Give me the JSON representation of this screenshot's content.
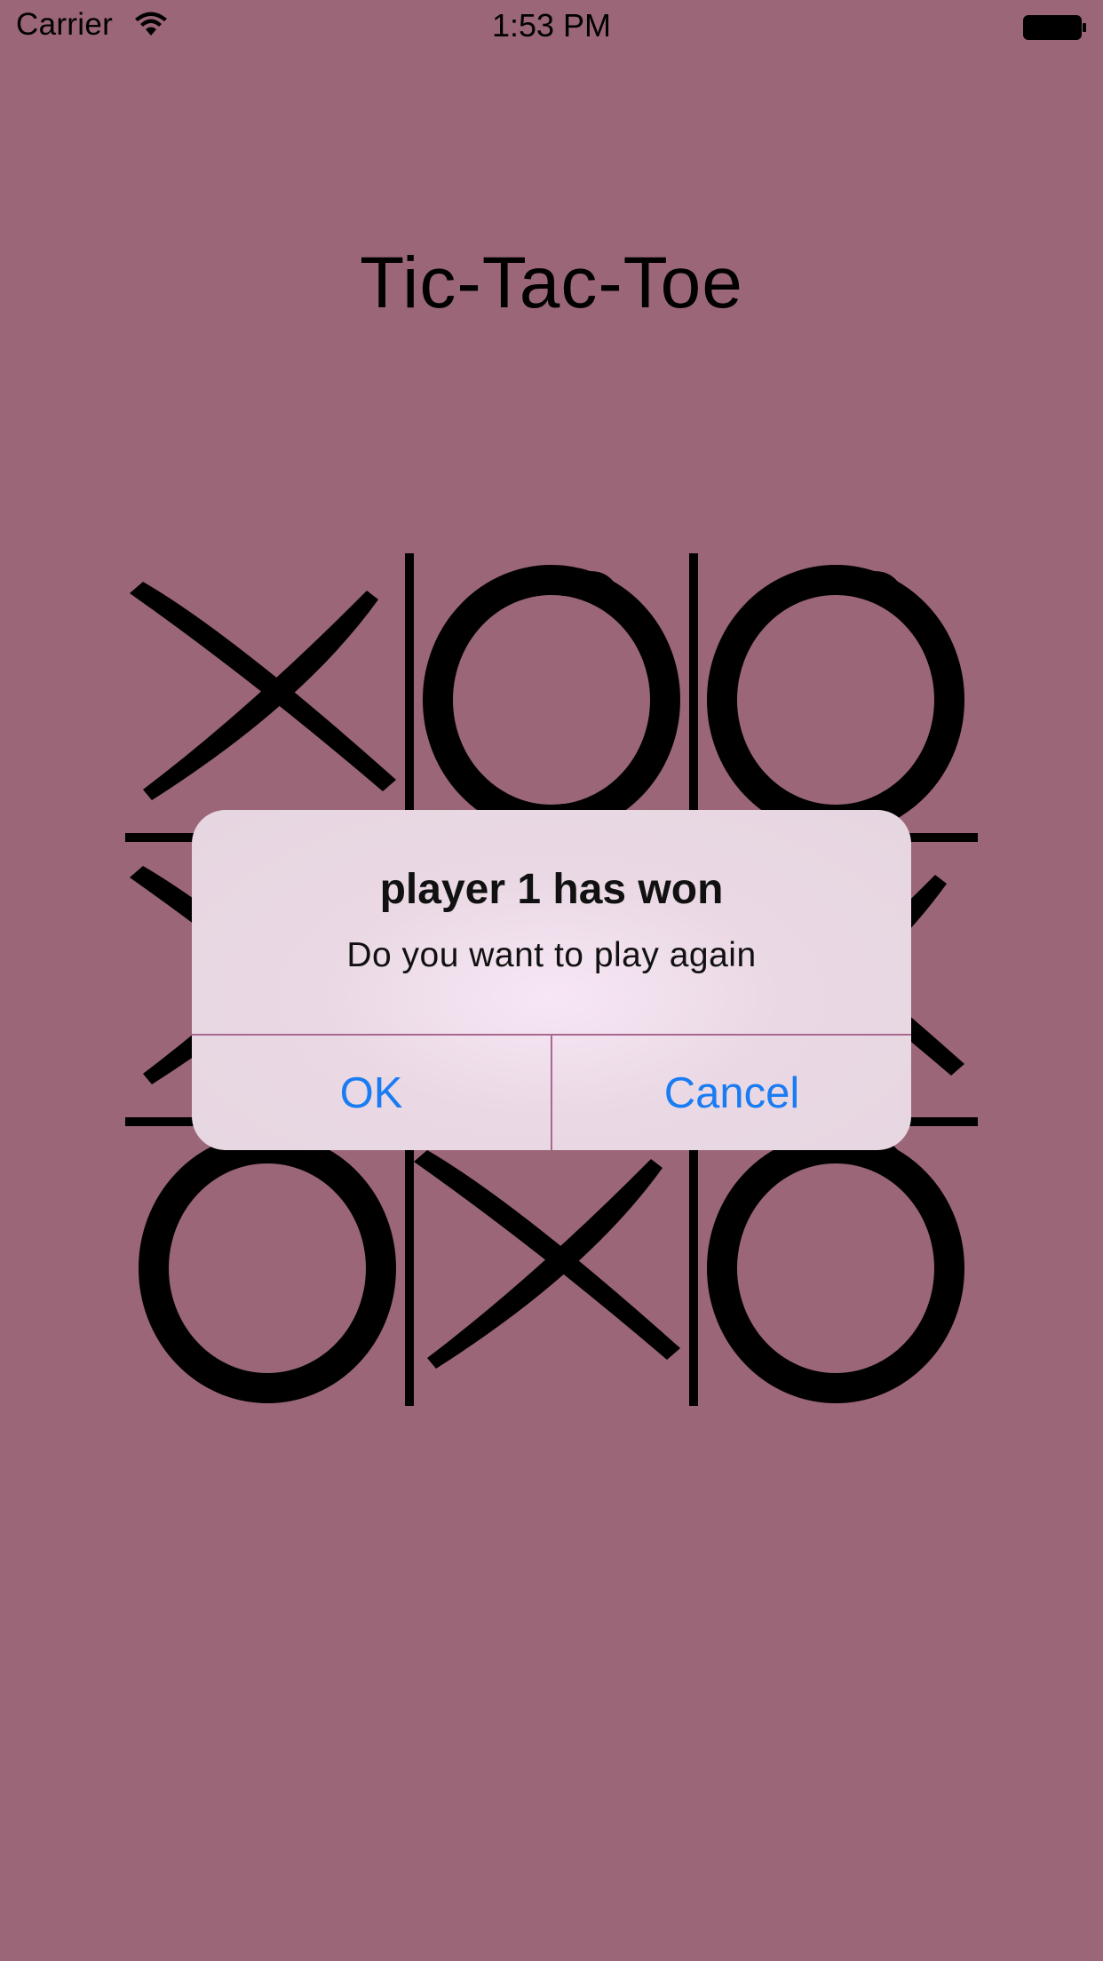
{
  "status_bar": {
    "carrier": "Carrier",
    "time": "1:53 PM",
    "wifi_icon": "wifi-icon",
    "battery_icon": "battery-full-icon"
  },
  "app": {
    "title": "Tic-Tac-Toe",
    "background_color": "#9a6678"
  },
  "board": {
    "cells": [
      "X",
      "O",
      "O",
      "X",
      "",
      "X",
      "O",
      "X",
      "O"
    ]
  },
  "alert": {
    "title": "player 1 has won",
    "message": "Do you want to play again",
    "buttons": [
      {
        "label": "OK"
      },
      {
        "label": "Cancel"
      }
    ],
    "button_color": "#1a7cf3"
  }
}
